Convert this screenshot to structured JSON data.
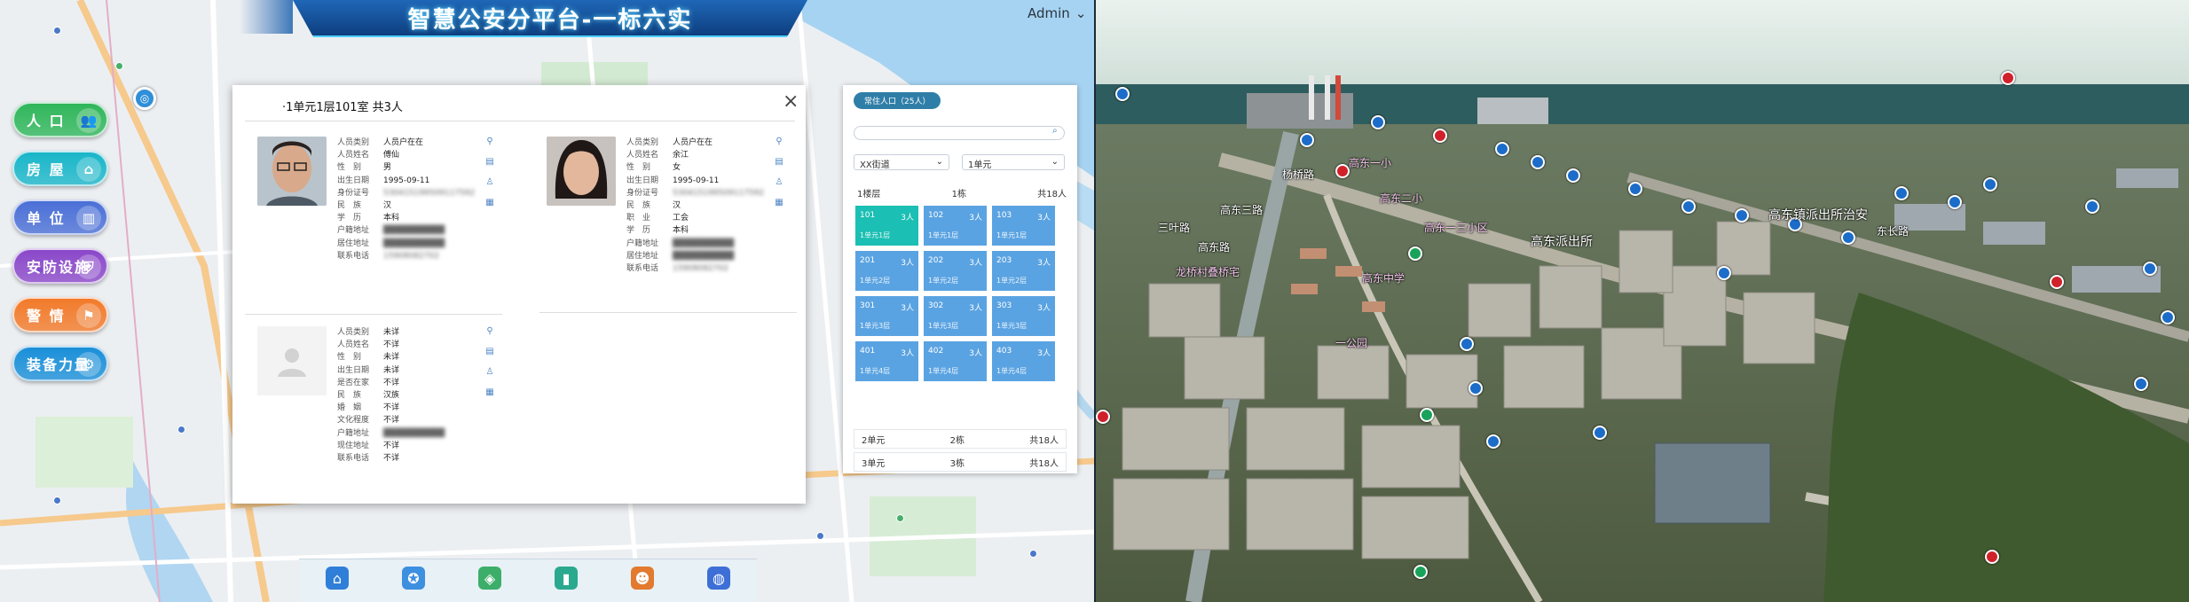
{
  "header": {
    "title": "智慧公安分平台-一标六实",
    "user": "Admin"
  },
  "side_nav": [
    {
      "label": "人 口",
      "icon": "people-icon",
      "color": "#2fb65a"
    },
    {
      "label": "房 屋",
      "icon": "house-icon",
      "color": "#19b6c9"
    },
    {
      "label": "单 位",
      "icon": "building-icon",
      "color": "#4a6fd6"
    },
    {
      "label": "安防设施",
      "icon": "shield-icon",
      "color": "#8a47c9"
    },
    {
      "label": "警 情",
      "icon": "alarm-icon",
      "color": "#f27a2a"
    },
    {
      "label": "装备力量",
      "icon": "gear-icon",
      "color": "#1a8fd8"
    }
  ],
  "dialog": {
    "title": "·1单元1层101室 共3人",
    "close": "×",
    "persons": [
      {
        "fields": [
          {
            "k": "人员类别",
            "v": "人员户在在",
            "blur": false
          },
          {
            "k": "人员姓名",
            "v": "傅仙",
            "blur": false
          },
          {
            "k": "性　别",
            "v": "男",
            "blur": false
          },
          {
            "k": "出生日期",
            "v": "1995-09-11",
            "blur": false
          },
          {
            "k": "身份证号",
            "v": "530415199509117592",
            "blur": true
          },
          {
            "k": "民　族",
            "v": "汉",
            "blur": false
          },
          {
            "k": "学　历",
            "v": "本科",
            "blur": false
          },
          {
            "k": "户籍地址",
            "v": "██████████",
            "blur": true
          },
          {
            "k": "居住地址",
            "v": "██████████",
            "blur": true
          },
          {
            "k": "联系电话",
            "v": "15908082702",
            "blur": true
          }
        ]
      },
      {
        "fields": [
          {
            "k": "人员类别",
            "v": "人员户在在",
            "blur": false
          },
          {
            "k": "人员姓名",
            "v": "余江",
            "blur": false
          },
          {
            "k": "性　别",
            "v": "女",
            "blur": false
          },
          {
            "k": "出生日期",
            "v": "1995-09-11",
            "blur": false
          },
          {
            "k": "身份证号",
            "v": "530415199509117592",
            "blur": true
          },
          {
            "k": "民　族",
            "v": "汉",
            "blur": false
          },
          {
            "k": "职　业",
            "v": "工会",
            "blur": false
          },
          {
            "k": "学　历",
            "v": "本科",
            "blur": false
          },
          {
            "k": "户籍地址",
            "v": "██████████",
            "blur": true
          },
          {
            "k": "居住地址",
            "v": "██████████",
            "blur": true
          },
          {
            "k": "联系电话",
            "v": "15908082702",
            "blur": true
          }
        ]
      },
      {
        "fields": [
          {
            "k": "人员类别",
            "v": "未详",
            "blur": false
          },
          {
            "k": "人员姓名",
            "v": "不详",
            "blur": false
          },
          {
            "k": "性　别",
            "v": "未详",
            "blur": false
          },
          {
            "k": "出生日期",
            "v": "未详",
            "blur": false
          },
          {
            "k": "是否在家",
            "v": "不详",
            "blur": false
          },
          {
            "k": "民　族",
            "v": "汉族",
            "blur": false
          },
          {
            "k": "婚　姻",
            "v": "不详",
            "blur": false
          },
          {
            "k": "文化程度",
            "v": "不详",
            "blur": false
          },
          {
            "k": "户籍地址",
            "v": "██████████",
            "blur": true
          },
          {
            "k": "现住地址",
            "v": "不详",
            "blur": false
          },
          {
            "k": "联系电话",
            "v": "不详",
            "blur": false
          }
        ]
      }
    ]
  },
  "unit_panel": {
    "tab": "常住人口（25人）",
    "search_placeholder": "",
    "select_a": "XX街道",
    "select_b": "1单元",
    "head": {
      "floor": "1楼层",
      "bldg": "1栋",
      "total": "共18人"
    },
    "rooms": [
      {
        "no": "101",
        "count": "3人",
        "tag": "1单元1层",
        "active": true
      },
      {
        "no": "102",
        "count": "3人",
        "tag": "1单元1层",
        "active": false
      },
      {
        "no": "103",
        "count": "3人",
        "tag": "1单元1层",
        "active": false
      },
      {
        "no": "201",
        "count": "3人",
        "tag": "1单元2层",
        "active": false
      },
      {
        "no": "202",
        "count": "3人",
        "tag": "1单元2层",
        "active": false
      },
      {
        "no": "203",
        "count": "3人",
        "tag": "1单元2层",
        "active": false
      },
      {
        "no": "301",
        "count": "3人",
        "tag": "1单元3层",
        "active": false
      },
      {
        "no": "302",
        "count": "3人",
        "tag": "1单元3层",
        "active": false
      },
      {
        "no": "303",
        "count": "3人",
        "tag": "1单元3层",
        "active": false
      },
      {
        "no": "401",
        "count": "3人",
        "tag": "1单元4层",
        "active": false
      },
      {
        "no": "402",
        "count": "3人",
        "tag": "1单元4层",
        "active": false
      },
      {
        "no": "403",
        "count": "3人",
        "tag": "1单元4层",
        "active": false
      }
    ],
    "rows": [
      {
        "a": "2单元",
        "b": "2栋",
        "c": "共18人"
      },
      {
        "a": "3单元",
        "b": "3栋",
        "c": "共18人"
      }
    ]
  },
  "dock": [
    {
      "icon": "home-icon",
      "color": "#2f7fd8"
    },
    {
      "icon": "police-icon",
      "color": "#3d8fe0"
    },
    {
      "icon": "cube-icon",
      "color": "#3cae6a"
    },
    {
      "icon": "book-icon",
      "color": "#2aa98f"
    },
    {
      "icon": "person-pin-icon",
      "color": "#e27a2f"
    },
    {
      "icon": "globe-icon",
      "color": "#3d6fd6"
    }
  ],
  "right_labels": [
    {
      "t": "高东镇派出所治安",
      "cls": "big"
    },
    {
      "t": "高东派出所",
      "cls": "big"
    },
    {
      "t": "高东一三小区",
      "cls": "pink"
    },
    {
      "t": "龙桥村叠桥宅",
      "cls": "pink"
    },
    {
      "t": "杨桥路",
      "cls": ""
    },
    {
      "t": "高东三路",
      "cls": ""
    },
    {
      "t": "东长路",
      "cls": ""
    },
    {
      "t": "高东二小",
      "cls": "pink"
    },
    {
      "t": "高东一小",
      "cls": "pink"
    },
    {
      "t": "高东中学",
      "cls": "pink"
    },
    {
      "t": "三叶路",
      "cls": ""
    },
    {
      "t": "高东路",
      "cls": ""
    },
    {
      "t": "一公园",
      "cls": "pink"
    }
  ]
}
